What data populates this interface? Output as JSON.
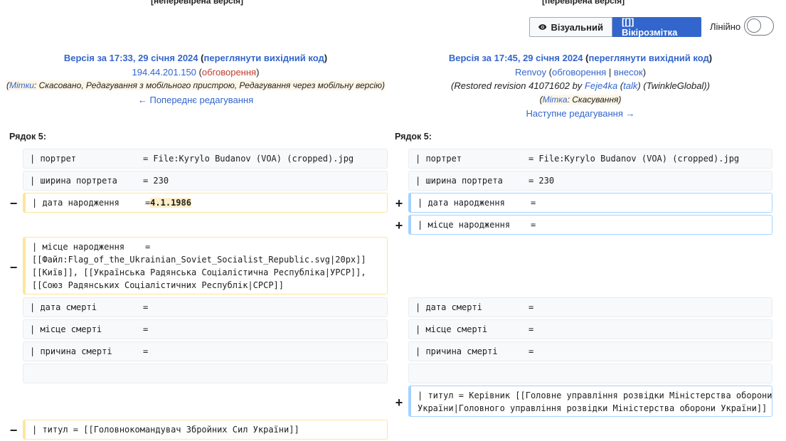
{
  "left": {
    "cut_title": "[неперевірена версія]",
    "version": "Версія за 17:33, 29 січня 2024",
    "source_link": "переглянути вихідний код",
    "user": "194.44.201.150",
    "talk": "обговорення",
    "tags_label": "Мітки",
    "tags_text": "Скасовано, Редагування з мобільного пристрою, Редагування через мобільну версію",
    "nav": "← Попереднє редагування",
    "row_label": "Рядок 5:"
  },
  "right": {
    "cut_title": "[перевірена версія]",
    "version": "Версія за 17:45, 29 січня 2024",
    "source_link": "переглянути вихідний код",
    "user": "Renvoy",
    "talk": "обговорення",
    "contrib": "внесок",
    "summary_start": "(Restored revision 41071602 by ",
    "summary_user": "Feje4ka",
    "summary_talk": "talk",
    "summary_end": ") (TwinkleGlobal))",
    "tag_label": "Мітка",
    "tag_text": "Скасування",
    "nav": "Наступне редагування →",
    "row_label": "Рядок 5:"
  },
  "toolbar": {
    "visual_label": "Візуальний",
    "wiki_label": "[[]] Вікірозмітка",
    "inline_label": "Лінійно",
    "inline_on": false
  },
  "diff": {
    "minus": "−",
    "plus": "+",
    "left_rows": {
      "portrait": "| портрет             = File:Kyrylo Budanov (VOA) (cropped).jpg",
      "width": "| ширина портрета     = 230",
      "birth_date_prefix": "| дата народження     =",
      "birth_date_value": "4.1.1986",
      "birth_place": "| місце народження    =\n[[Файл:Flag_of_the_Ukrainian_Soviet_Socialist_Republic.svg|20px]]\n[[Київ]], [[Українська Радянська Соціалістична Республіка|УРСР]],\n[[Союз Радянських Соціалістичних Республік|СРСР]]",
      "death_date": "| дата смерті         =",
      "death_place": "| місце смерті        =",
      "death_cause": "| причина смерті      =",
      "empty": "",
      "title": "| титул = [[Головнокомандувач Збройних Сил України]]"
    },
    "right_rows": {
      "portrait": "| портрет             = File:Kyrylo Budanov (VOA) (cropped).jpg",
      "width": "| ширина портрета     = 230",
      "birth_date": "| дата народження     =",
      "birth_place": "| місце народження    =",
      "death_date": "| дата смерті         =",
      "death_place": "| місце смерті        =",
      "death_cause": "| причина смерті      =",
      "empty": "",
      "title": "| титул = Керівник [[Головне управління розвідки Міністерства оборони\nУкраїни|Головного управління розвідки Міністерства оборони України]]"
    }
  }
}
